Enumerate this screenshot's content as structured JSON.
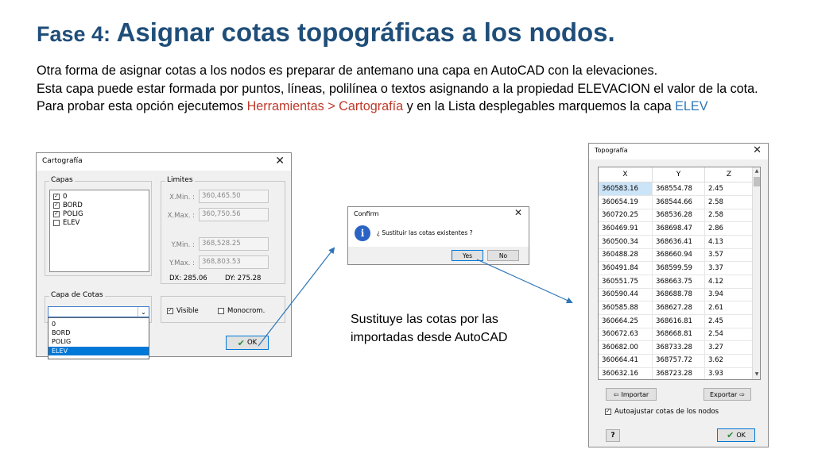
{
  "slide": {
    "title_prefix": "Fase 4: ",
    "title_main": "Asignar cotas topográficas a los nodos.",
    "para1": "Otra forma de asignar cotas a los nodos es preparar de antemano una capa en AutoCAD con la elevaciones.",
    "para2": "Esta capa puede estar formada por puntos, líneas, polilínea o textos asignando a la propiedad ELEVACION el valor de la cota.",
    "para3_a": "Para probar esta opción ejecutemos ",
    "para3_menu": "Herramientas > Cartografía",
    "para3_b": " y en la Lista desplegables marquemos la capa ",
    "para3_layer": "ELEV",
    "caption": "Sustituye las cotas por las importadas desde AutoCAD"
  },
  "cartografia": {
    "title": "Cartografía",
    "capas_label": "Capas",
    "layers": [
      {
        "name": "0",
        "checked": true
      },
      {
        "name": "BORD",
        "checked": true
      },
      {
        "name": "POLIG",
        "checked": true
      },
      {
        "name": "ELEV",
        "checked": false
      }
    ],
    "limites_label": "Limites",
    "xmin_label": "X.Min. :",
    "xmin_value": "360,465.50",
    "xmax_label": "X.Max. :",
    "xmax_value": "360,750.56",
    "ymin_label": "Y.Min. :",
    "ymin_value": "368,528.25",
    "ymax_label": "Y.Max. :",
    "ymax_value": "368,803.53",
    "dx": "DX: 285.06",
    "dy": "DY: 275.28",
    "capa_cotas_label": "Capa de Cotas",
    "dropdown_options": [
      "0",
      "BORD",
      "POLIG",
      "ELEV"
    ],
    "dropdown_selected": "ELEV",
    "visible_label": "Visible",
    "visible_checked": true,
    "monocrom_label": "Monocrom.",
    "monocrom_checked": false,
    "ok_label": "OK"
  },
  "confirm": {
    "title": "Confirm",
    "message": "¿ Sustituir las cotas existentes ?",
    "yes_label": "Yes",
    "no_label": "No"
  },
  "topografia": {
    "title": "Topografía",
    "columns": [
      "X",
      "Y",
      "Z"
    ],
    "rows": [
      [
        "360583.16",
        "368554.78",
        "2.45"
      ],
      [
        "360654.19",
        "368544.66",
        "2.58"
      ],
      [
        "360720.25",
        "368536.28",
        "2.58"
      ],
      [
        "360469.91",
        "368698.47",
        "2.86"
      ],
      [
        "360500.34",
        "368636.41",
        "4.13"
      ],
      [
        "360488.28",
        "368660.94",
        "3.57"
      ],
      [
        "360491.84",
        "368599.59",
        "3.37"
      ],
      [
        "360551.75",
        "368663.75",
        "4.12"
      ],
      [
        "360590.44",
        "368688.78",
        "3.94"
      ],
      [
        "360585.88",
        "368627.28",
        "2.61"
      ],
      [
        "360664.25",
        "368616.81",
        "2.45"
      ],
      [
        "360672.63",
        "368668.81",
        "2.54"
      ],
      [
        "360682.00",
        "368733.28",
        "3.27"
      ],
      [
        "360664.41",
        "368757.72",
        "3.62"
      ],
      [
        "360632.16",
        "368723.28",
        "3.93"
      ]
    ],
    "importar_label": "Importar",
    "exportar_label": "Exportar",
    "autoajustar_label": "Autoajustar cotas de los nodos",
    "autoajustar_checked": true,
    "help_label": "?",
    "ok_label": "OK"
  }
}
